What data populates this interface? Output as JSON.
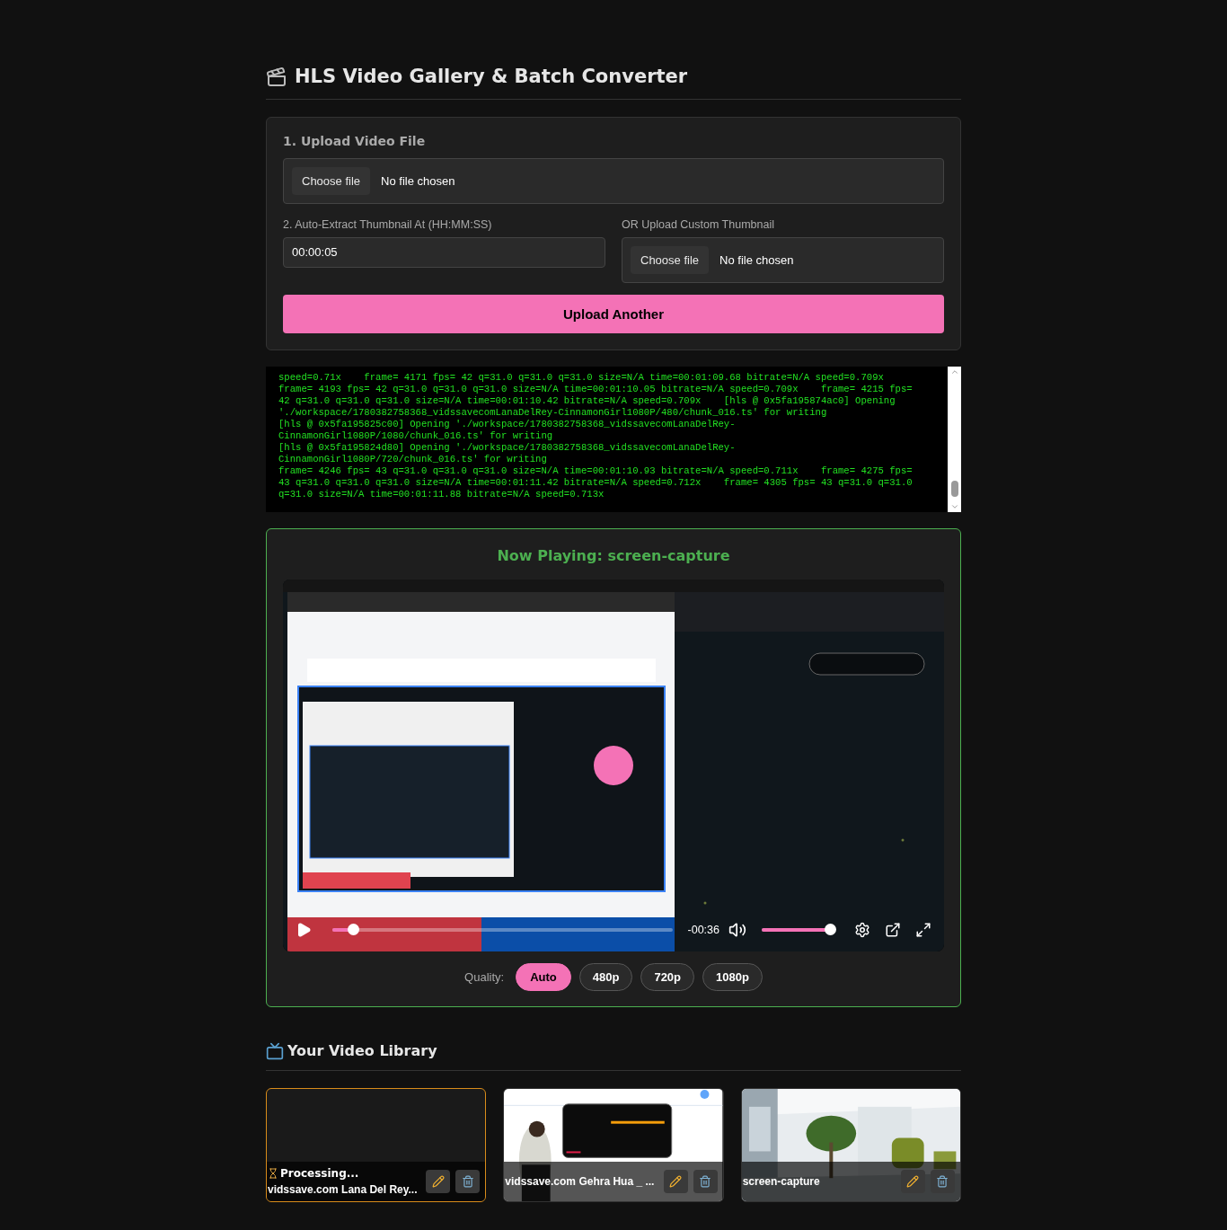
{
  "page": {
    "title": "HLS Video Gallery & Batch Converter"
  },
  "upload": {
    "heading": "1. Upload Video File",
    "video_file": {
      "button": "Choose file",
      "status": "No file chosen"
    },
    "thumbnail_time": {
      "label": "2. Auto-Extract Thumbnail At (HH:MM:SS)",
      "value": "00:00:05"
    },
    "custom_thumbnail": {
      "label": "OR Upload Custom Thumbnail",
      "button": "Choose file",
      "status": "No file chosen"
    },
    "submit": "Upload Another"
  },
  "log": {
    "lines": [
      "speed=0.71x    frame= 4171 fps= 42 q=31.0 q=31.0 q=31.0 size=N/A time=00:01:09.68 bitrate=N/A speed=0.709x",
      "frame= 4193 fps= 42 q=31.0 q=31.0 q=31.0 size=N/A time=00:01:10.05 bitrate=N/A speed=0.709x    frame= 4215 fps=",
      "42 q=31.0 q=31.0 q=31.0 size=N/A time=00:01:10.42 bitrate=N/A speed=0.709x    [hls @ 0x5fa195874ac0] Opening",
      "'./workspace/1780382758368_vidssavecomLanaDelRey-CinnamonGirl1080P/480/chunk_016.ts' for writing",
      "[hls @ 0x5fa195825c00] Opening './workspace/1780382758368_vidssavecomLanaDelRey-",
      "CinnamonGirl1080P/1080/chunk_016.ts' for writing",
      "[hls @ 0x5fa195824d80] Opening './workspace/1780382758368_vidssavecomLanaDelRey-",
      "CinnamonGirl1080P/720/chunk_016.ts' for writing",
      "frame= 4246 fps= 43 q=31.0 q=31.0 q=31.0 size=N/A time=00:01:10.93 bitrate=N/A speed=0.711x    frame= 4275 fps=",
      "43 q=31.0 q=31.0 q=31.0 size=N/A time=00:01:11.42 bitrate=N/A speed=0.712x    frame= 4305 fps= 43 q=31.0 q=31.0",
      "q=31.0 size=N/A time=00:01:11.88 bitrate=N/A speed=0.713x"
    ]
  },
  "player": {
    "title": "Now Playing: screen-capture",
    "progress": {
      "level": 0.06
    },
    "time": "-00:36",
    "volume": {
      "level": 1
    },
    "quality_label": "Quality:",
    "qualities": [
      {
        "label": "Auto",
        "selected": true
      },
      {
        "label": "480p",
        "selected": false
      },
      {
        "label": "720p",
        "selected": false
      },
      {
        "label": "1080p",
        "selected": false
      }
    ]
  },
  "library": {
    "title": "Your Video Library",
    "videos": [
      {
        "status": "Processing...",
        "name": "vidssave.com Lana Del Rey...",
        "processing": true,
        "has_thumbnail": false
      },
      {
        "name": "vidssave.com Gehra Hua _ ...",
        "processing": false,
        "has_thumbnail": true
      },
      {
        "name": "screen-capture",
        "processing": false,
        "has_thumbnail": true
      }
    ]
  }
}
